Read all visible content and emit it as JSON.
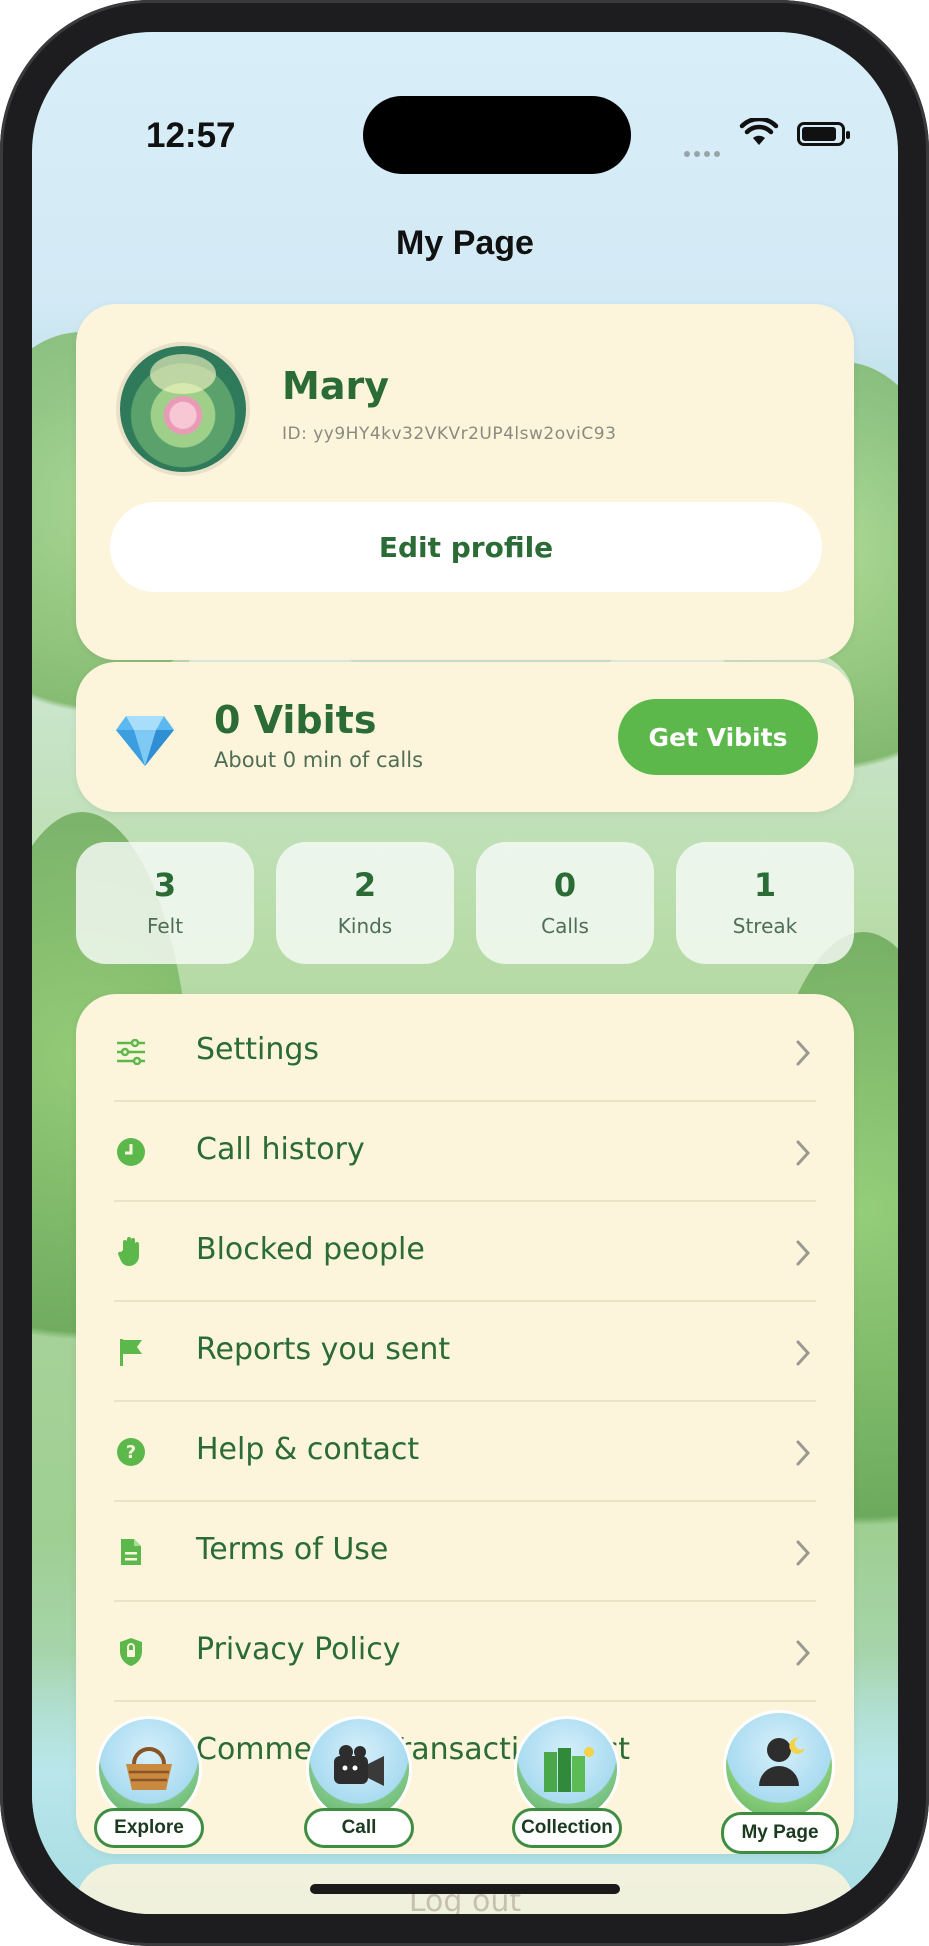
{
  "status_bar": {
    "time": "12:57"
  },
  "header": {
    "title": "My Page"
  },
  "profile": {
    "name": "Mary",
    "id_text": "ID: yy9HY4kv32VKVr2UP4lsw2oviC93",
    "edit_label": "Edit profile"
  },
  "vibits": {
    "count_text": "0 Vibits",
    "subtitle": "About 0 min of calls",
    "get_label": "Get Vibits"
  },
  "stats": [
    {
      "value": "3",
      "label": "Felt"
    },
    {
      "value": "2",
      "label": "Kinds"
    },
    {
      "value": "0",
      "label": "Calls"
    },
    {
      "value": "1",
      "label": "Streak"
    }
  ],
  "menu": [
    {
      "label": "Settings",
      "icon": "sliders-icon"
    },
    {
      "label": "Call history",
      "icon": "clock-icon"
    },
    {
      "label": "Blocked people",
      "icon": "hand-icon"
    },
    {
      "label": "Reports you sent",
      "icon": "flag-icon"
    },
    {
      "label": "Help & contact",
      "icon": "question-icon"
    },
    {
      "label": "Terms of Use",
      "icon": "document-icon"
    },
    {
      "label": "Privacy Policy",
      "icon": "shield-icon"
    },
    {
      "label": "Commercial Transactions Act",
      "icon": "receipt-icon"
    }
  ],
  "logout": {
    "label": "Log out"
  },
  "tabbar": [
    {
      "label": "Explore",
      "icon": "basket-icon"
    },
    {
      "label": "Call",
      "icon": "camera-icon"
    },
    {
      "label": "Collection",
      "icon": "books-icon"
    },
    {
      "label": "My Page",
      "icon": "person-icon",
      "active": true
    }
  ],
  "colors": {
    "accent": "#5db84c",
    "text_green": "#2a6b36",
    "card": "#fdf5db"
  }
}
